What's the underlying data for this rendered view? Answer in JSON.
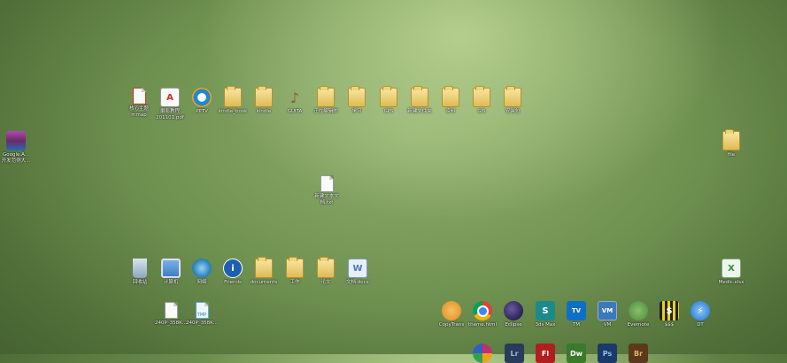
{
  "desktop": {
    "icons": [
      {
        "name": "xmind-file-icon",
        "label": "核心主题\nmmap",
        "kind": "doc",
        "color": "#c0392b"
      },
      {
        "name": "pdf-file-icon",
        "label": "摄影教程\n201101.pdf",
        "kind": "pdf",
        "color": "#d42a1e"
      },
      {
        "name": "pptv-icon",
        "label": "PPTV",
        "kind": "circle",
        "color": "#1e88d0"
      },
      {
        "name": "folder-icon",
        "label": "kindle_book",
        "kind": "folder"
      },
      {
        "name": "folder-icon",
        "label": "kindle",
        "kind": "folder"
      },
      {
        "name": "guitar-icon",
        "label": "GUITA",
        "kind": "glyph",
        "color": "#8d5a2b"
      },
      {
        "name": "folder-icon",
        "label": "正在编辑的",
        "kind": "folder"
      },
      {
        "name": "folder-icon",
        "label": "学习",
        "kind": "folder"
      },
      {
        "name": "folder-icon",
        "label": "GPS",
        "kind": "folder"
      },
      {
        "name": "folder-icon",
        "label": "新建文件夹",
        "kind": "folder"
      },
      {
        "name": "folder-icon",
        "label": "资料",
        "kind": "folder"
      },
      {
        "name": "folder-icon",
        "label": "GIS",
        "kind": "folder"
      },
      {
        "name": "folder-icon",
        "label": "安装包",
        "kind": "folder"
      },
      {
        "name": "winrar-archive-icon",
        "label": "Google.A...\n开发范例大...",
        "kind": "glyph",
        "color": "#7a3a7a"
      },
      {
        "name": "folder-icon",
        "label": "file",
        "kind": "folder"
      },
      {
        "name": "text-file-icon",
        "label": "新建文本文\n档.txt",
        "kind": "doc"
      },
      {
        "name": "recycle-bin-icon",
        "label": "回收站",
        "kind": "glyph",
        "color": "#8aa6c0"
      },
      {
        "name": "computer-icon",
        "label": "计算机",
        "kind": "glyph",
        "color": "#3f7fc2"
      },
      {
        "name": "network-icon",
        "label": "网络",
        "kind": "circle",
        "color": "#2e86c1"
      },
      {
        "name": "info-icon",
        "label": "Friends",
        "kind": "circle",
        "color": "#1f5fb0"
      },
      {
        "name": "folder-icon",
        "label": "documents",
        "kind": "folder"
      },
      {
        "name": "folder-icon",
        "label": "工作",
        "kind": "folder"
      },
      {
        "name": "folder-icon",
        "label": "论文",
        "kind": "folder"
      },
      {
        "name": "word-doc-icon",
        "label": "文档.docx",
        "kind": "glyph",
        "color": "#4a78c0"
      },
      {
        "name": "excel-file-icon",
        "label": "Medic.xlsx",
        "kind": "glyph",
        "color": "#3a8a3a"
      },
      {
        "name": "blank-file-icon",
        "label": "240P_358K...",
        "kind": "doc"
      },
      {
        "name": "temp-file-icon",
        "label": "240P_358K...",
        "kind": "doc"
      },
      {
        "name": "copytrans-icon",
        "label": "CopyTrans",
        "kind": "circle",
        "color": "#e08a1e"
      },
      {
        "name": "chrome-icon",
        "label": "theme.html",
        "kind": "circle",
        "color": "#db4437"
      },
      {
        "name": "eclipse-icon",
        "label": "Eclipse",
        "kind": "circle",
        "color": "#2c2255"
      },
      {
        "name": "3ds-max-icon",
        "label": "3ds Max",
        "kind": "glyph",
        "color": "#1b8a8a"
      },
      {
        "name": "teamviewer-icon",
        "label": "TM",
        "kind": "glyph",
        "color": "#0e6fc7"
      },
      {
        "name": "vmware-icon",
        "label": "VM",
        "kind": "glyph",
        "color": "#3a7ab8"
      },
      {
        "name": "evernote-icon",
        "label": "Evernote",
        "kind": "circle",
        "color": "#4a8a3a"
      },
      {
        "name": "money-app-icon",
        "label": "$$$",
        "kind": "glyph",
        "color": "#222222"
      },
      {
        "name": "daemon-tools-icon",
        "label": "DT",
        "kind": "circle",
        "color": "#1a6fd0"
      },
      {
        "name": "picasa-icon",
        "label": "",
        "kind": "circle",
        "color": "#c0306a"
      },
      {
        "name": "lightroom-icon",
        "label": "",
        "kind": "glyph",
        "color": "#2a3a5a"
      },
      {
        "name": "flash-icon",
        "label": "",
        "kind": "glyph",
        "color": "#b01e1e"
      },
      {
        "name": "dreamweaver-icon",
        "label": "",
        "kind": "glyph",
        "color": "#3a7a2a"
      },
      {
        "name": "photoshop-icon",
        "label": "",
        "kind": "glyph",
        "color": "#1a3a6a"
      },
      {
        "name": "bridge-icon",
        "label": "",
        "kind": "glyph",
        "color": "#5a3a1a"
      }
    ],
    "glyph_text": {
      "pdf": "A",
      "info": "i",
      "word": "W",
      "excel": "X",
      "3ds": "S",
      "tm": "TV",
      "vm": "VM",
      "lr": "Lr",
      "fl": "Fl",
      "dw": "Dw",
      "ps": "Ps",
      "br": "Br",
      "dt": "⚡",
      "money": "$",
      "temp": "TMP"
    }
  }
}
